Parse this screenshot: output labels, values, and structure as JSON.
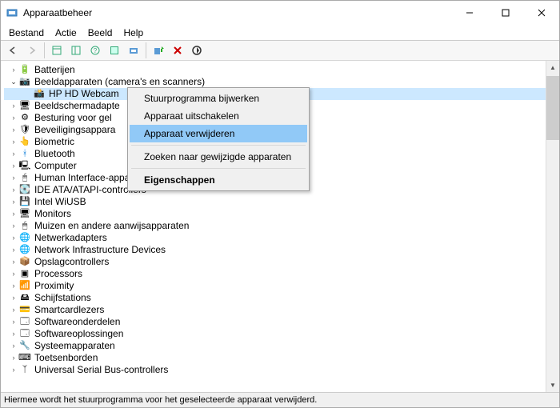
{
  "window": {
    "title": "Apparaatbeheer"
  },
  "menu": {
    "file": "Bestand",
    "action": "Actie",
    "view": "Beeld",
    "help": "Help"
  },
  "tree": {
    "items": [
      {
        "indent": 1,
        "expand": "closed",
        "icon": "battery",
        "label": "Batterijen"
      },
      {
        "indent": 1,
        "expand": "open",
        "icon": "camera",
        "label": "Beeldapparaten (camera's en scanners)"
      },
      {
        "indent": 2,
        "expand": "none",
        "icon": "webcam",
        "label": "HP HD Webcam",
        "selected": true,
        "truncate": true
      },
      {
        "indent": 1,
        "expand": "closed",
        "icon": "monitor",
        "label": "Beeldschermadapte",
        "cut": true
      },
      {
        "indent": 1,
        "expand": "closed",
        "icon": "device",
        "label": "Besturing voor gel",
        "cut": true
      },
      {
        "indent": 1,
        "expand": "closed",
        "icon": "shield",
        "label": "Beveiligingsappara",
        "cut": true
      },
      {
        "indent": 1,
        "expand": "closed",
        "icon": "finger",
        "label": "Biometric"
      },
      {
        "indent": 1,
        "expand": "closed",
        "icon": "bt",
        "label": "Bluetooth"
      },
      {
        "indent": 1,
        "expand": "closed",
        "icon": "pc",
        "label": "Computer"
      },
      {
        "indent": 1,
        "expand": "closed",
        "icon": "hid",
        "label": "Human Interface-apparaten (HID)"
      },
      {
        "indent": 1,
        "expand": "closed",
        "icon": "ide",
        "label": "IDE ATA/ATAPI-controllers"
      },
      {
        "indent": 1,
        "expand": "closed",
        "icon": "wiusb",
        "label": "Intel WiUSB"
      },
      {
        "indent": 1,
        "expand": "closed",
        "icon": "monitor",
        "label": "Monitors"
      },
      {
        "indent": 1,
        "expand": "closed",
        "icon": "mouse",
        "label": "Muizen en andere aanwijsapparaten"
      },
      {
        "indent": 1,
        "expand": "closed",
        "icon": "net",
        "label": "Netwerkadapters"
      },
      {
        "indent": 1,
        "expand": "closed",
        "icon": "net",
        "label": "Network Infrastructure Devices"
      },
      {
        "indent": 1,
        "expand": "closed",
        "icon": "storage",
        "label": "Opslagcontrollers"
      },
      {
        "indent": 1,
        "expand": "closed",
        "icon": "cpu",
        "label": "Processors"
      },
      {
        "indent": 1,
        "expand": "closed",
        "icon": "prox",
        "label": "Proximity"
      },
      {
        "indent": 1,
        "expand": "closed",
        "icon": "disk",
        "label": "Schijfstations"
      },
      {
        "indent": 1,
        "expand": "closed",
        "icon": "smart",
        "label": "Smartcardlezers"
      },
      {
        "indent": 1,
        "expand": "closed",
        "icon": "sw",
        "label": "Softwareonderdelen"
      },
      {
        "indent": 1,
        "expand": "closed",
        "icon": "sw",
        "label": "Softwareoplossingen"
      },
      {
        "indent": 1,
        "expand": "closed",
        "icon": "chip",
        "label": "Systeemapparaten"
      },
      {
        "indent": 1,
        "expand": "closed",
        "icon": "kbd",
        "label": "Toetsenborden"
      },
      {
        "indent": 1,
        "expand": "closed",
        "icon": "usb",
        "label": "Universal Serial Bus-controllers",
        "cutoff": true
      }
    ]
  },
  "context_menu": {
    "update": "Stuurprogramma bijwerken",
    "disable": "Apparaat uitschakelen",
    "remove": "Apparaat verwijderen",
    "scan": "Zoeken naar gewijzigde apparaten",
    "props": "Eigenschappen"
  },
  "status": "Hiermee wordt het stuurprogramma voor het geselecteerde apparaat verwijderd.",
  "icons": {
    "battery": "🔋",
    "camera": "📷",
    "webcam": "📸",
    "monitor": "🖥",
    "device": "⚙",
    "shield": "🛡",
    "finger": "👆",
    "bt": "ᚼ",
    "pc": "🖳",
    "hid": "🖰",
    "ide": "💽",
    "wiusb": "💾",
    "mouse": "🖱",
    "net": "🌐",
    "storage": "📦",
    "cpu": "▣",
    "prox": "📶",
    "disk": "🖴",
    "smart": "💳",
    "sw": "🗔",
    "chip": "🔧",
    "kbd": "⌨",
    "usb": "ᛉ"
  },
  "colors": {
    "bt": "#0078d7"
  }
}
